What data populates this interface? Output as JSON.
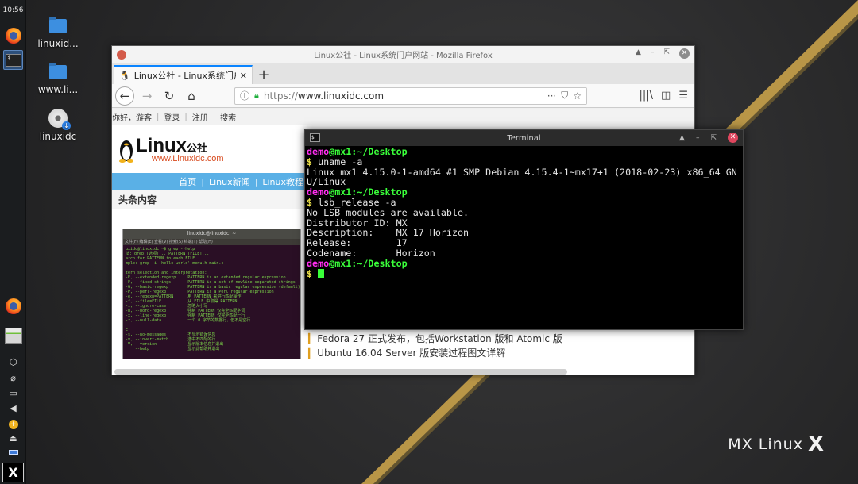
{
  "panel": {
    "clock": "10:56",
    "tray": [
      "firefox-icon",
      "file-manager-icon",
      "package-icon",
      "paperclip-icon",
      "display-icon",
      "volume-icon",
      "updater-icon",
      "eject-icon",
      "keyboard-icon"
    ]
  },
  "desktop_icons": [
    {
      "label": "linuxid...",
      "kind": "folder"
    },
    {
      "label": "www.li...",
      "kind": "folder"
    },
    {
      "label": "linuxidc",
      "kind": "disc"
    }
  ],
  "firefox": {
    "window_title": "Linux公社 - Linux系统门户网站 - Mozilla Firefox",
    "tab_title": "Linux公社 - Linux系统门户",
    "url_host": "www.linuxidc.com",
    "url_scheme": "https://",
    "page": {
      "topstrip": [
        "你好，游客",
        "登录",
        "注册",
        "搜索"
      ],
      "logo_text": "Linux",
      "logo_suffix": "公社",
      "logo_sub": "www.Linuxidc.com",
      "nav": [
        "首页",
        "Linux新闻",
        "Linux教程"
      ],
      "headline": "头条内容",
      "thumb_title": "linuxidc@linuxidc: ~",
      "thumb_menu": "文件(F) 编辑(E) 查看(V) 搜索(S) 终端(T) 帮助(H)",
      "thumb_body": "uxidc@linuxidc:~$ grep --help\n法: grep [选项]... PATTERN [FILE]...\narch for PATTERN in each FILE.\nmple: grep -i 'hello world' menu.h main.c\n\ntern selection and interpretation:\n-E, --extended-regexp     PATTERN is an extended regular expression\n-F, --fixed-strings       PATTERN is a set of newline-separated strings\n-G, --basic-regexp        PATTERN is a basic regular expression (default)\n-P, --perl-regexp         PATTERN is a Perl regular expression\n-e, --regexp=PATTERN      用 PATTERN 来进行匹配操作\n-f, --file=FILE           从 FILE 中取得 PATTERN\n-i, --ignore-case         忽略大小写\n-w, --word-regexp         强制 PATTERN 仅完全匹配字词\n-x, --line-regexp         强制 PATTERN 仅完全匹配一行\n-z, --null-data           一个 0 字节的数据行，但不是空行\n\nc:\n-s, --no-messages         不显示错误信息\n-v, --invert-match        选中不匹配的行\n-V, --version             显示版本信息并退出\n    --help                显示此帮助并退出",
      "news": [
        "Fedora 27 正式发布，包括Workstation 版和 Atomic 版",
        "Ubuntu 16.04 Server 版安装过程图文详解"
      ]
    }
  },
  "terminal": {
    "title": "Terminal",
    "user": "demo",
    "host": "@mx1",
    "path": ":~/Desktop",
    "lines": [
      {
        "type": "prompt"
      },
      {
        "type": "cmd",
        "text": "uname -a"
      },
      {
        "type": "out",
        "text": "Linux mx1 4.15.0-1-amd64 #1 SMP Debian 4.15.4-1~mx17+1 (2018-02-23) x86_64 GN"
      },
      {
        "type": "out",
        "text": "U/Linux"
      },
      {
        "type": "prompt"
      },
      {
        "type": "cmd",
        "text": "lsb_release -a"
      },
      {
        "type": "out",
        "text": "No LSB modules are available."
      },
      {
        "type": "out",
        "text": "Distributor ID: MX"
      },
      {
        "type": "out",
        "text": "Description:    MX 17 Horizon"
      },
      {
        "type": "out",
        "text": "Release:        17"
      },
      {
        "type": "out",
        "text": "Codename:       Horizon"
      },
      {
        "type": "prompt"
      },
      {
        "type": "cursor"
      }
    ]
  },
  "brand": {
    "text": "MX Linux",
    "mark": "X"
  },
  "colors": {
    "accent": "#0a84ff",
    "prompt_user": "#ff2ef0",
    "prompt_host": "#3aff3a",
    "stripe": "#c9a24a"
  }
}
